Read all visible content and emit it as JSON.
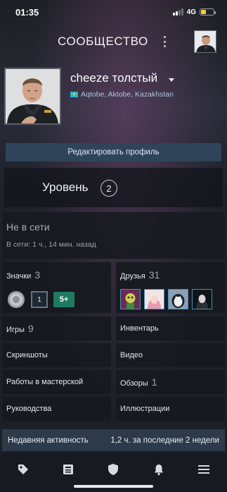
{
  "status_bar": {
    "time": "01:35",
    "network": "4G",
    "battery_percent": 40
  },
  "top_bar": {
    "title": "СООБЩЕСТВО"
  },
  "profile": {
    "name": "cheeze толстый",
    "location": "Aqtobe, Aktobe, Kazakhstan",
    "edit_button": "Редактировать профиль"
  },
  "level": {
    "label": "Уровень",
    "value": "2"
  },
  "status": {
    "state": "Не в сети",
    "last_online": "В сети: 1 ч., 14 мин. назад"
  },
  "sections": {
    "badges": {
      "label": "Значки",
      "count": "3"
    },
    "friends": {
      "label": "Друзья",
      "count": "31"
    },
    "games": {
      "label": "Игры",
      "count": "9"
    },
    "inventory": {
      "label": "Инвентарь"
    },
    "screenshots": {
      "label": "Скриншоты"
    },
    "videos": {
      "label": "Видео"
    },
    "workshop": {
      "label": "Работы в мастерской"
    },
    "reviews": {
      "label": "Обзоры",
      "count": "1"
    },
    "guides": {
      "label": "Руководства"
    },
    "artwork": {
      "label": "Иллюстрации"
    }
  },
  "badge_items": [
    "coin-badge",
    "level-1-badge",
    "years-5-badge"
  ],
  "badge_texts": {
    "level": "1",
    "years": "5+"
  },
  "recent_activity": {
    "label": "Недавняя активность",
    "value": "1,2 ч. за последние 2 недели"
  },
  "bottom_nav": [
    "store-tag-icon",
    "library-icon",
    "community-shield-icon",
    "notifications-bell-icon",
    "menu-icon"
  ],
  "colors": {
    "accent_blue": "#2f4459",
    "activity_bar": "#2c3a4a",
    "location_text": "#a9c6e0"
  }
}
